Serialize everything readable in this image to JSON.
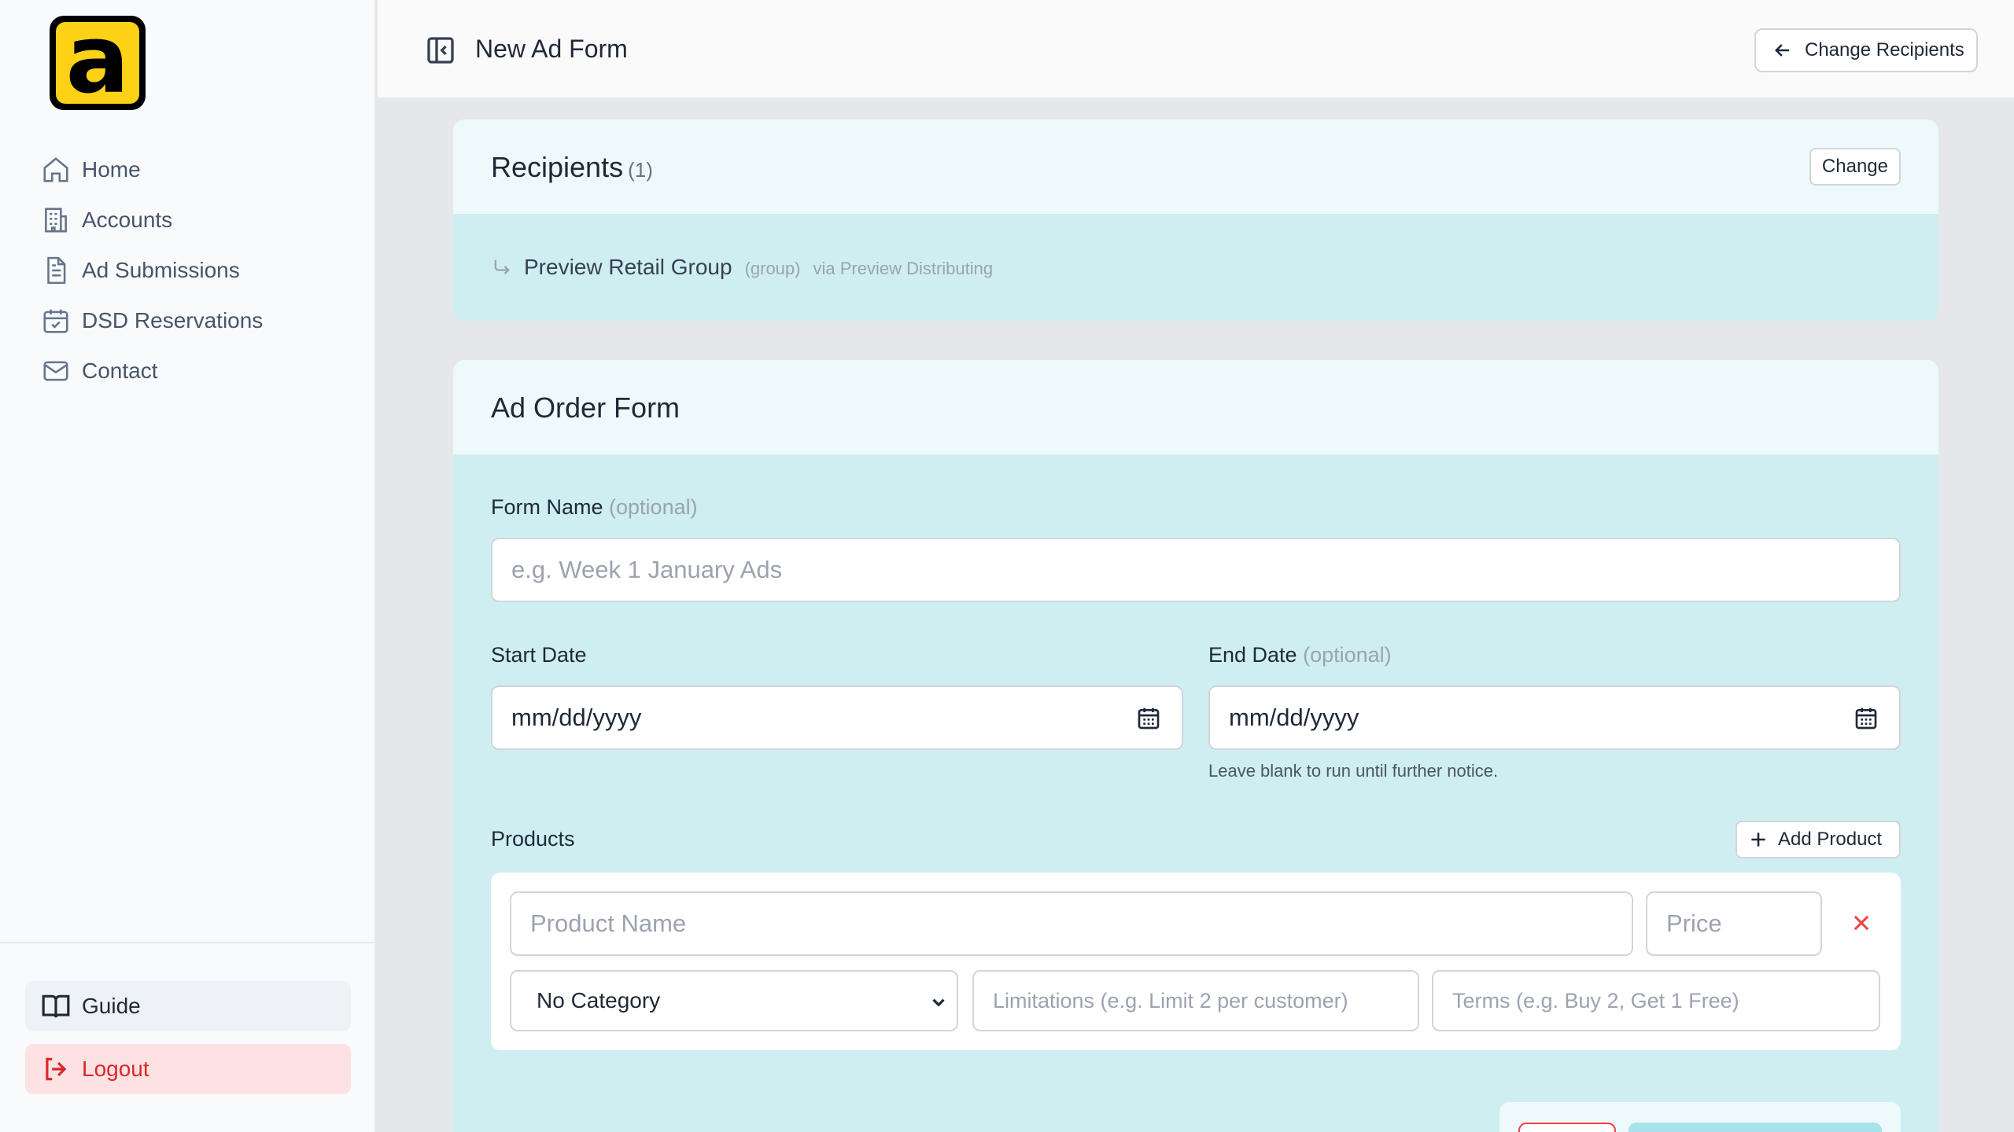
{
  "sidebar": {
    "logo_letter": "a",
    "nav": [
      {
        "label": "Home",
        "icon": "home-icon"
      },
      {
        "label": "Accounts",
        "icon": "building-icon"
      },
      {
        "label": "Ad Submissions",
        "icon": "document-icon"
      },
      {
        "label": "DSD Reservations",
        "icon": "calendar-check-icon"
      },
      {
        "label": "Contact",
        "icon": "mail-icon"
      }
    ],
    "guide_label": "Guide",
    "logout_label": "Logout"
  },
  "header": {
    "title": "New Ad Form",
    "change_recipients_label": "Change Recipients"
  },
  "recipients": {
    "title": "Recipients",
    "count": "(1)",
    "change_label": "Change",
    "items": [
      {
        "name": "Preview Retail Group",
        "type": "(group)",
        "via": "via Preview Distributing"
      }
    ]
  },
  "order_form": {
    "title": "Ad Order Form",
    "form_name": {
      "label": "Form Name",
      "optional": "(optional)",
      "placeholder": "e.g. Week 1 January Ads"
    },
    "start_date": {
      "label": "Start Date",
      "value": "mm/dd/yyyy"
    },
    "end_date": {
      "label": "End Date",
      "optional": "(optional)",
      "value": "mm/dd/yyyy",
      "hint": "Leave blank to run until further notice."
    },
    "products": {
      "label": "Products",
      "add_label": "Add Product",
      "product_name_placeholder": "Product Name",
      "price_placeholder": "Price",
      "category_value": "No Category",
      "limitations_placeholder": "Limitations (e.g. Limit 2 per customer)",
      "terms_placeholder": "Terms (e.g. Buy 2, Get 1 Free)"
    }
  },
  "colors": {
    "accent_yellow": "#fcd116",
    "card_body": "#cfeef2",
    "card_head": "#eef9fb",
    "danger": "#dc2626"
  }
}
